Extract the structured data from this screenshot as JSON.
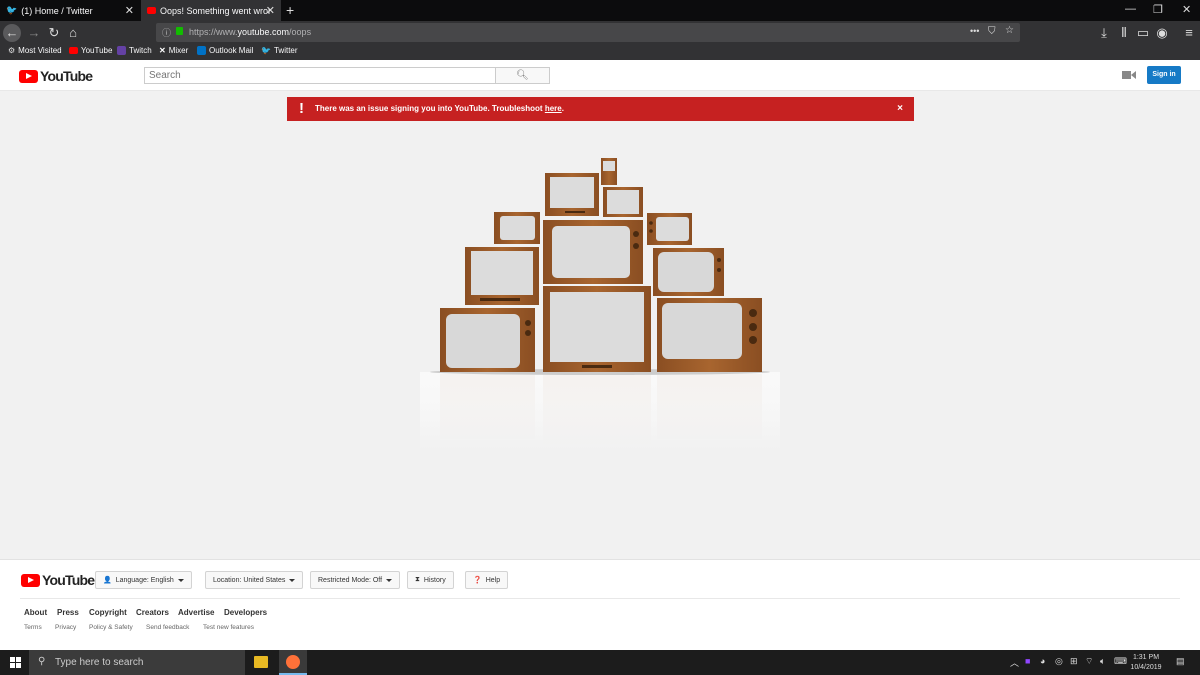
{
  "browser": {
    "tabs": [
      {
        "label": "(1) Home / Twitter",
        "active": false
      },
      {
        "label": "Oops! Something went wrong",
        "active": true
      }
    ],
    "url_prefix": "https://www.",
    "url_host": "youtube.com",
    "url_path": "/oops",
    "bookmarks": [
      "Most Visited",
      "YouTube",
      "Twitch",
      "Mixer",
      "Outlook Mail",
      "Twitter"
    ]
  },
  "header": {
    "logo_text": "YouTube",
    "search_placeholder": "Search",
    "signin_label": "Sign in"
  },
  "alert": {
    "message": "There was an issue signing you into YouTube. Troubleshoot ",
    "link_text": "here",
    "message_end": ".",
    "close": "×"
  },
  "footer": {
    "logo_text": "YouTube",
    "language": "Language: English",
    "location": "Location: United States",
    "restricted": "Restricted Mode: Off",
    "history": "History",
    "help": "Help",
    "links": [
      "About",
      "Press",
      "Copyright",
      "Creators",
      "Advertise",
      "Developers"
    ],
    "sub_links": [
      "Terms",
      "Privacy",
      "Policy & Safety",
      "Send feedback",
      "Test new features"
    ]
  },
  "taskbar": {
    "search_placeholder": "Type here to search",
    "time": "1:31 PM",
    "date": "10/4/2019"
  },
  "colors": {
    "alert": "#c62121",
    "brand_red": "#ff0000",
    "signin_blue": "#167ac6",
    "tv_wood": "#9a5a2a"
  }
}
